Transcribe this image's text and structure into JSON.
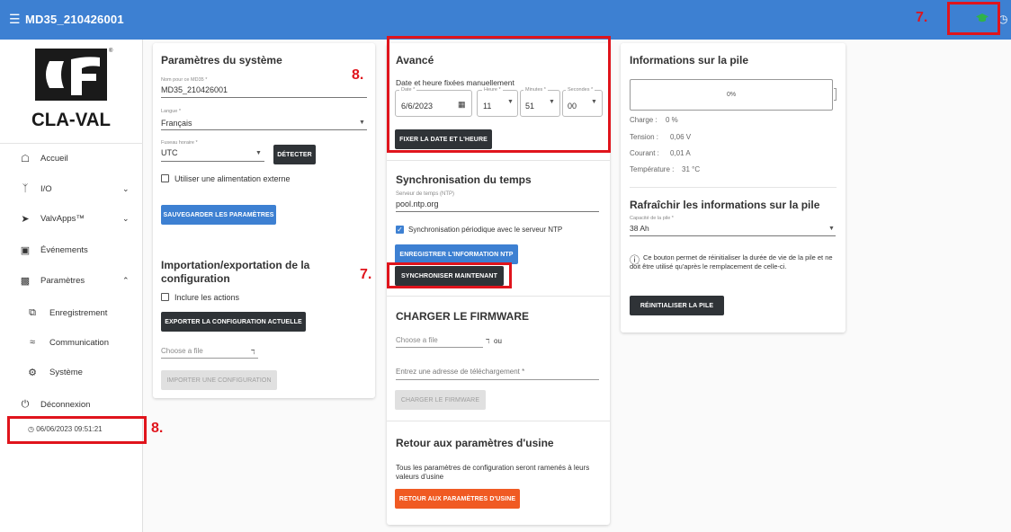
{
  "app": {
    "title": "MD35_210426001",
    "menu_icon": "hamburger-icon",
    "cap_icon": "graduation-cap-icon",
    "clock_icon": "clock-icon"
  },
  "brand": {
    "name": "CLA-VAL",
    "registered": "®"
  },
  "sidebar": {
    "items": [
      {
        "label": "Accueil",
        "icon": "home-icon"
      },
      {
        "label": "I/O",
        "icon": "io-icon",
        "chevron": "chevron-down-icon"
      },
      {
        "label": "ValvApps™",
        "icon": "valvapps-icon",
        "chevron": "chevron-down-icon"
      },
      {
        "label": "Événements",
        "icon": "calendar-icon"
      },
      {
        "label": "Paramètres",
        "icon": "settings-box-icon",
        "chevron": "chevron-up-icon"
      },
      {
        "label": "Enregistrement",
        "icon": "copy-icon"
      },
      {
        "label": "Communication",
        "icon": "wifi-icon"
      },
      {
        "label": "Système",
        "icon": "gear-icon"
      },
      {
        "label": "Déconnexion",
        "icon": "power-icon"
      }
    ],
    "timestamp": "06/06/2023 09:51:21"
  },
  "system": {
    "title": "Paramètres du système",
    "name_label": "Nom pour ce MD35 *",
    "name_value": "MD35_210426001",
    "language_label": "Langue *",
    "language_value": "Français",
    "timezone_label": "Fuseau horaire *",
    "timezone_value": "UTC",
    "detect": "DÉTECTER",
    "external_power": "Utiliser une alimentation externe",
    "save": "SAUVEGARDER LES PARAMÈTRES"
  },
  "import_export": {
    "title_line1": "Importation/exportation de la",
    "title_line2": "configuration",
    "include_actions": "Inclure les actions",
    "export": "EXPORTER LA CONFIGURATION ACTUELLE",
    "choose_file": "Choose a file",
    "import": "IMPORTER UNE CONFIGURATION"
  },
  "advanced": {
    "title": "Avancé",
    "subtitle": "Date et heure fixées manuellement",
    "date_label": "Date *",
    "date_value": "6/6/2023",
    "hour_label": "Heure *",
    "hour_value": "11",
    "minutes_label": "Minutes *",
    "minutes_value": "51",
    "seconds_label": "Secondes *",
    "seconds_value": "00",
    "set_button": "FIXER LA DATE ET L'HEURE"
  },
  "time_sync": {
    "title": "Synchronisation du temps",
    "server_label": "Serveur de temps (NTP)",
    "server_value": "pool.ntp.org",
    "periodic": "Synchronisation périodique avec le serveur NTP",
    "save_ntp": "ENREGISTRER L'INFORMATION NTP",
    "sync_now": "SYNCHRONISER MAINTENANT"
  },
  "firmware": {
    "title": "CHARGER LE FIRMWARE",
    "choose_file": "Choose a file",
    "or": "ou",
    "url_placeholder": "Entrez une adresse de téléchargement *",
    "load": "CHARGER LE FIRMWARE"
  },
  "factory": {
    "title": "Retour aux paramètres d'usine",
    "text": "Tous les paramètres de configuration seront ramenés à leurs valeurs d'usine",
    "button": "RETOUR AUX PARAMÈTRES D'USINE"
  },
  "battery": {
    "title": "Informations sur la pile",
    "percent_text": "0%",
    "charge_fraction": 0,
    "rows": [
      {
        "label": "Charge :",
        "value": "0 %"
      },
      {
        "label": "Tension :",
        "value": "0,06 V"
      },
      {
        "label": "Courant :",
        "value": "0,01 A"
      },
      {
        "label": "Température :",
        "value": "31 °C"
      }
    ],
    "refresh_title": "Rafraîchir les informations sur la pile",
    "capacity_label": "Capacité de la pile *",
    "capacity_value": "38 Ah",
    "info_text": "Ce bouton permet de réinitialiser la durée de vie de la pile et ne doit être utilisé qu'après le remplacement de celle-ci.",
    "reset": "RÉINITIALISER LA PILE"
  },
  "annotations": {
    "seven": "7.",
    "eight": "8."
  },
  "colors": {
    "topbar": "#3d80d2",
    "annotation": "#e0141c",
    "orange": "#f05a23",
    "dark_button": "#2f3337",
    "cap_icon": "#2fb24a"
  }
}
